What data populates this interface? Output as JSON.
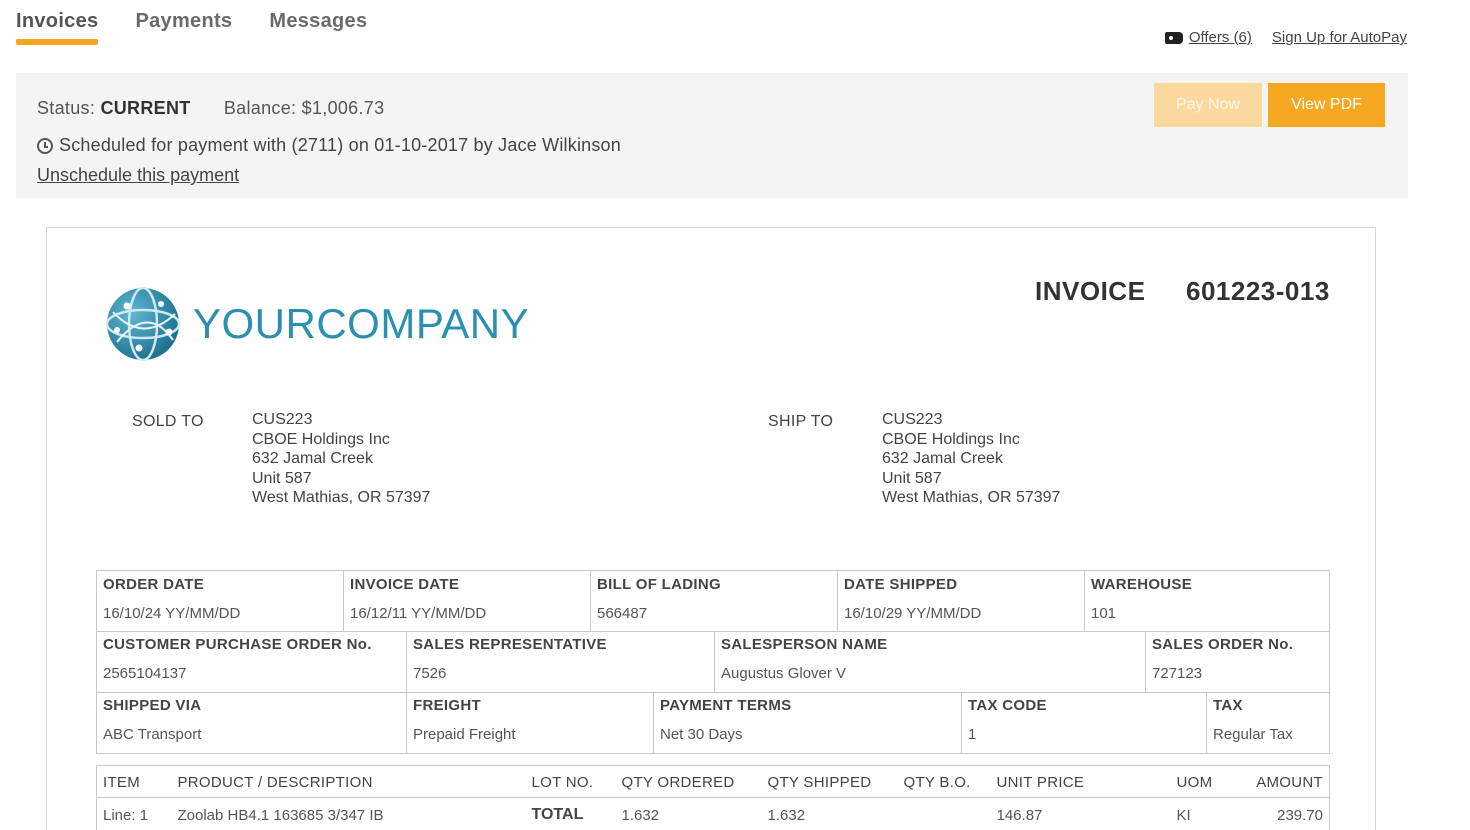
{
  "tabs": [
    {
      "label": "Invoices"
    },
    {
      "label": "Payments"
    },
    {
      "label": "Messages"
    }
  ],
  "top_links": {
    "offers": "Offers (6)",
    "autopay": "Sign Up for AutoPay"
  },
  "status": {
    "status_label": "Status:",
    "status_value": "CURRENT",
    "balance_label": "Balance:",
    "balance_value": "$1,006.73",
    "scheduled_text": "Scheduled for payment with (2711) on 01-10-2017 by Jace Wilkinson",
    "unschedule": "Unschedule this payment",
    "pay_now": "Pay Now",
    "view_pdf": "View PDF"
  },
  "invoice": {
    "company_name": "YOURCOMPANY",
    "title": "INVOICE",
    "number": "601223-013",
    "sold_to": {
      "label": "SOLD TO",
      "lines": [
        "CUS223",
        "CBOE Holdings Inc",
        "632 Jamal Creek",
        "Unit 587",
        "West Mathias, OR 57397"
      ]
    },
    "ship_to": {
      "label": "SHIP TO",
      "lines": [
        "CUS223",
        "CBOE Holdings Inc",
        "632 Jamal Creek",
        "Unit 587",
        "West Mathias, OR 57397"
      ]
    },
    "row1": [
      {
        "label": "ORDER DATE",
        "value": "16/10/24 YY/MM/DD"
      },
      {
        "label": "INVOICE DATE",
        "value": "16/12/11 YY/MM/DD"
      },
      {
        "label": "BILL OF LADING",
        "value": "566487"
      },
      {
        "label": "DATE SHIPPED",
        "value": "16/10/29 YY/MM/DD"
      },
      {
        "label": "WAREHOUSE",
        "value": "101"
      }
    ],
    "row2": [
      {
        "label": "CUSTOMER PURCHASE ORDER No.",
        "value": "2565104137"
      },
      {
        "label": "SALES REPRESENTATIVE",
        "value": "7526"
      },
      {
        "label": "SALESPERSON NAME",
        "value": "Augustus Glover V"
      },
      {
        "label": "SALES ORDER No.",
        "value": "727123"
      }
    ],
    "row3": [
      {
        "label": "SHIPPED VIA",
        "value": "ABC Transport"
      },
      {
        "label": "FREIGHT",
        "value": "Prepaid Freight"
      },
      {
        "label": "PAYMENT TERMS",
        "value": "Net 30 Days"
      },
      {
        "label": "TAX CODE",
        "value": "1"
      },
      {
        "label": "TAX",
        "value": "Regular Tax"
      }
    ],
    "items_headers": [
      "ITEM",
      "PRODUCT / DESCRIPTION",
      "LOT NO.",
      "QTY ORDERED",
      "QTY SHIPPED",
      "QTY B.O.",
      "UNIT PRICE",
      "UOM",
      "AMOUNT"
    ],
    "items": [
      {
        "item": "Line: 1",
        "description": "Zoolab HB4.1 163685 3/347 IB",
        "lot": "TOTAL",
        "qty_ordered": "1.632",
        "qty_shipped": "1.632",
        "qty_bo": "",
        "unit_price": "146.87",
        "uom": "KI",
        "amount": "239.70"
      }
    ]
  },
  "colors": {
    "accent": "#f7a823",
    "accent_disabled": "#fbd99e",
    "brand": "#2a8fb0",
    "status_bg": "#f4f4f4"
  }
}
